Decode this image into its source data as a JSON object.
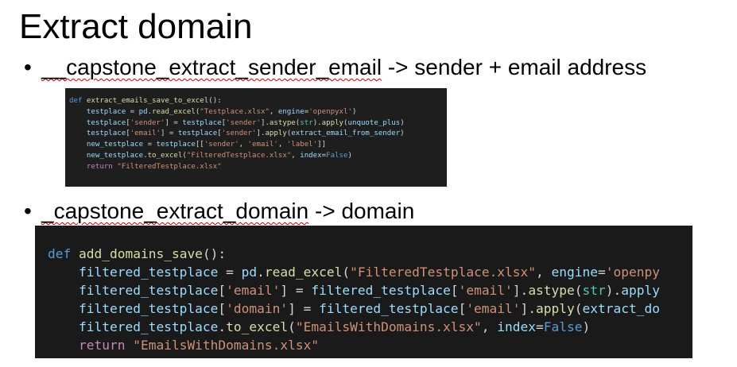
{
  "slide": {
    "title": "Extract domain",
    "bullets": [
      {
        "marker": "•",
        "name": "__capstone_extract_sender_email",
        "rest": " -> sender + email address"
      },
      {
        "marker": "•",
        "name": "_capstone_extract_domain",
        "rest": " -> domain"
      }
    ]
  },
  "code_blocks": [
    {
      "lines": [
        "def extract_emails_save_to_excel():",
        "    testplace = pd.read_excel(\"Testplace.xlsx\", engine='openpyxl')",
        "    testplace['sender'] = testplace['sender'].astype(str).apply(unquote_plus)",
        "    testplace['email'] = testplace['sender'].apply(extract_email_from_sender)",
        "    new_testplace = testplace[['sender', 'email', 'label']]",
        "    new_testplace.to_excel(\"FilteredTestplace.xlsx\", index=False)",
        "    return \"FilteredTestplace.xlsx\""
      ]
    },
    {
      "lines": [
        "def add_domains_save():",
        "    filtered_testplace = pd.read_excel(\"FilteredTestplace.xlsx\", engine='openpy",
        "    filtered_testplace['email'] = filtered_testplace['email'].astype(str).apply",
        "    filtered_testplace['domain'] = filtered_testplace['email'].apply(extract_do",
        "    filtered_testplace.to_excel(\"EmailsWithDomains.xlsx\", index=False)",
        "    return \"EmailsWithDomains.xlsx\""
      ]
    }
  ],
  "colors": {
    "code_background": "#1e1e1e",
    "keyword": "#569cd6",
    "function": "#dcdcaa",
    "variable": "#9cdcfe",
    "string": "#ce9178",
    "return": "#c586c0",
    "spellcheck_underline": "#c00000"
  }
}
